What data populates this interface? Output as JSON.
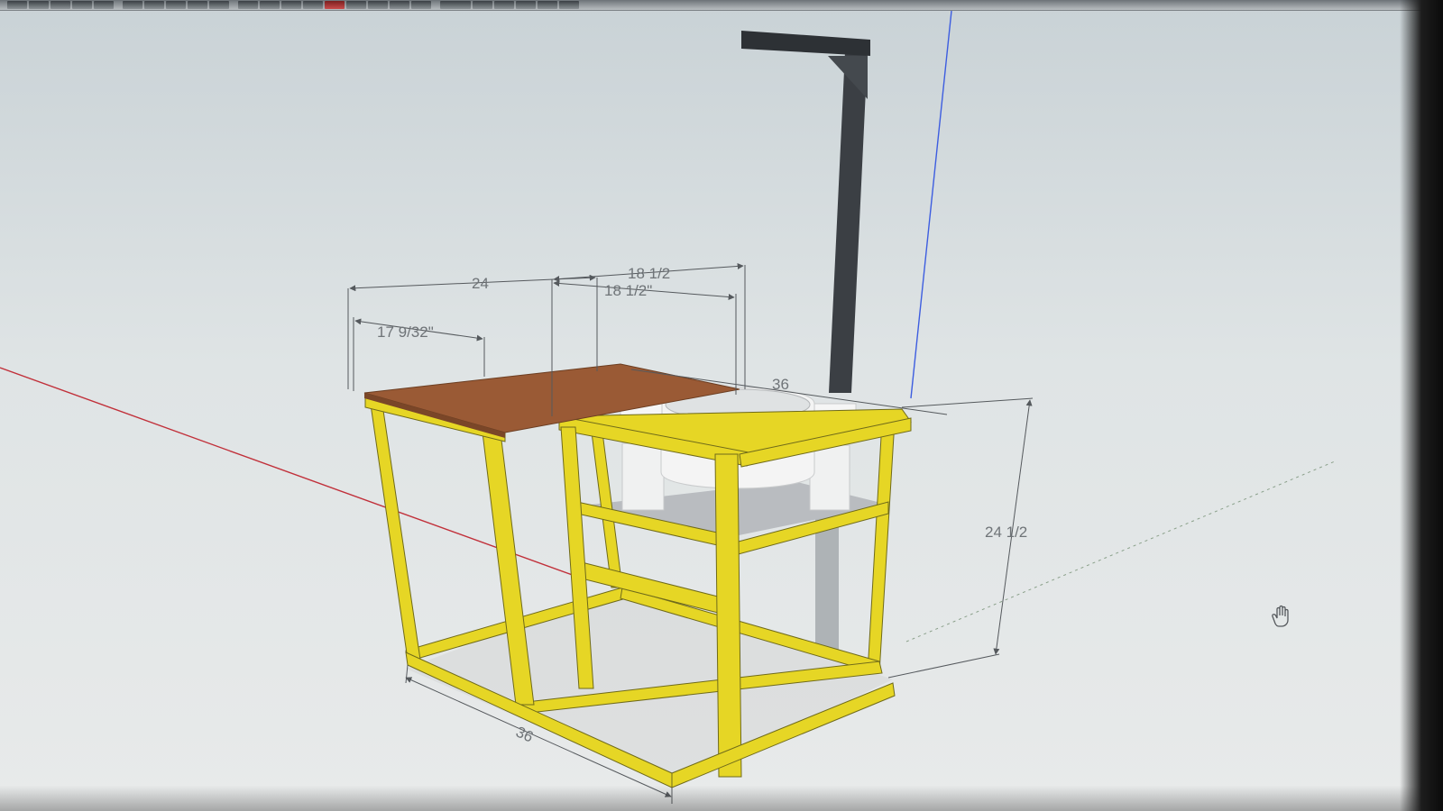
{
  "dimensions": {
    "top_width": "24",
    "upper_width_a": "18 1/2",
    "upper_width_b": "18 1/2\"",
    "top_depth": "17 9/32\"",
    "table_width": "36",
    "height": "24 1/2",
    "base_length": "36"
  },
  "colors": {
    "frame": "#e6d625",
    "frame_shadow": "#b2a416",
    "table_top": "#9a5a35",
    "post": "#3b3f44",
    "ring": "#f2f3f3",
    "shelf": "#b9bcc0",
    "axis_red": "#c1303a",
    "axis_blue": "#3d5de0",
    "dim_line": "#6f7478"
  },
  "icons": {
    "cursor": "hand-cursor-icon"
  }
}
